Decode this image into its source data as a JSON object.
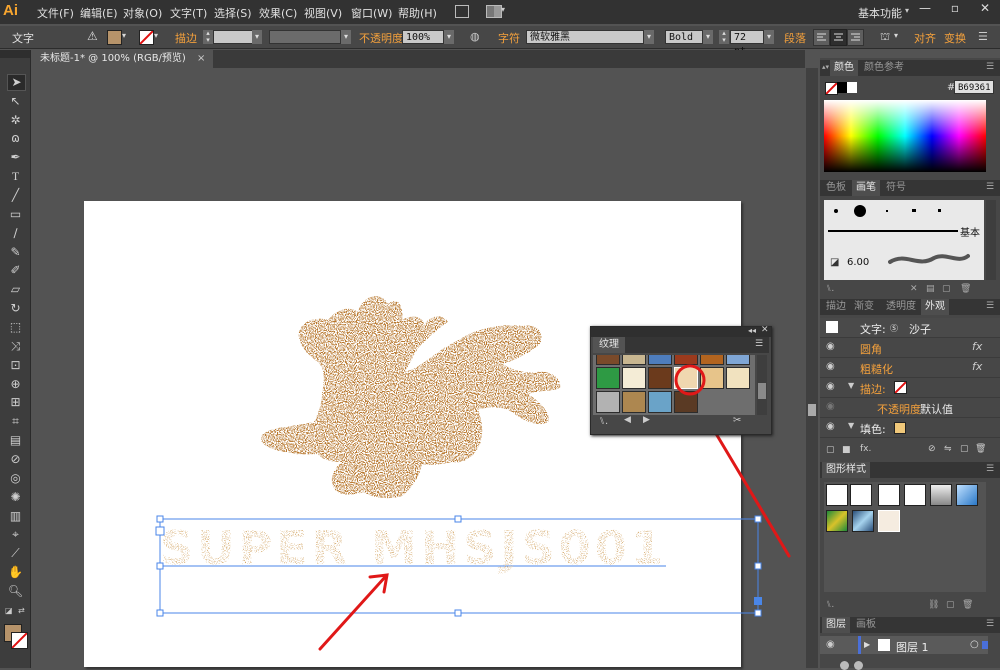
{
  "app": {
    "logo": "Ai"
  },
  "menubar": {
    "items": [
      "文件(F)",
      "编辑(E)",
      "对象(O)",
      "文字(T)",
      "选择(S)",
      "效果(C)",
      "视图(V)",
      "窗口(W)",
      "帮助(H)"
    ],
    "workspace": "基本功能"
  },
  "controlbar": {
    "type_label": "文字",
    "stroke_label": "描边",
    "opacity_label": "不透明度",
    "opacity_value": "100%",
    "char_label": "字符",
    "font_value": "微软雅黑",
    "style_value": "Bold",
    "size_value": "72 pt",
    "para_label": "段落",
    "align_label": "对齐",
    "transform_label": "变换",
    "fill_color": "#b6936a"
  },
  "document": {
    "tab_label": "未标题-1* @ 100% (RGB/预览)"
  },
  "canvas": {
    "text_content": "SUPER MHSJS001",
    "sand_color": "#b8782f"
  },
  "texture_panel": {
    "title": "纹理"
  },
  "color_panel": {
    "tabs": [
      "颜色",
      "颜色参考"
    ],
    "hex_prefix": "#",
    "hex_value": "B69361"
  },
  "brush_panel": {
    "tabs": [
      "色板",
      "画笔",
      "符号"
    ],
    "basic_label": "基本",
    "size_label": "6.00"
  },
  "appearance_panel": {
    "tabs": [
      "描边",
      "渐变",
      "透明度",
      "外观"
    ],
    "header": "文字: ",
    "header_name": "沙子",
    "rows": [
      {
        "name": "圆角",
        "fx": "fx"
      },
      {
        "name": "粗糙化",
        "fx": "fx"
      },
      {
        "name": "描边:"
      },
      {
        "name": "不透明度",
        "value": "默认值"
      },
      {
        "name": "填色:"
      }
    ]
  },
  "graphic_styles": {
    "title": "图形样式"
  },
  "layers_panel": {
    "tabs": [
      "图层",
      "画板"
    ],
    "layer_name": "图层 1"
  }
}
